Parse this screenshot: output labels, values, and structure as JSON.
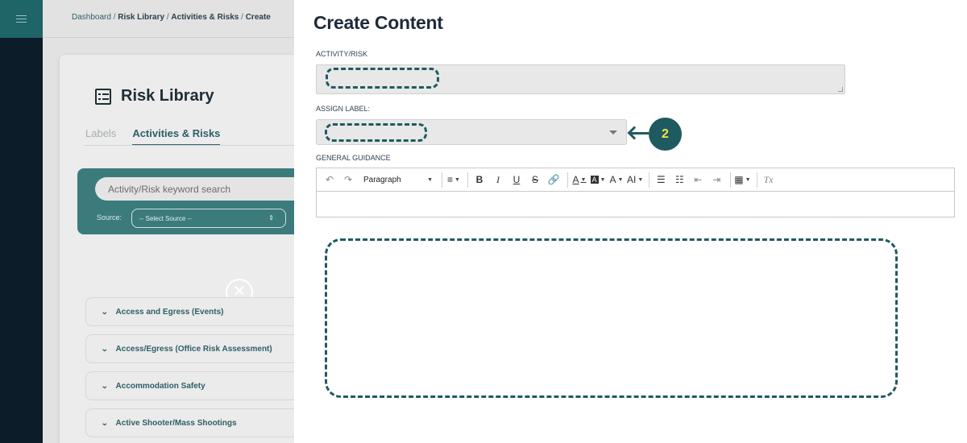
{
  "sidebar": {
    "menu_icon": "hamburger-menu-icon"
  },
  "breadcrumb": {
    "home": "Dashboard",
    "sep": " / ",
    "items": [
      "Risk Library",
      "Activities & Risks",
      "Create"
    ]
  },
  "library": {
    "title": "Risk Library",
    "title_icon": "checklist-icon",
    "tabs": [
      "Labels",
      "Activities & Risks"
    ],
    "active_tab": "Activities & Risks",
    "search_placeholder": "Activity/Risk keyword search",
    "source_label": "Source:",
    "source_value": "-- Select Source --",
    "accordion_items": [
      "Access and Egress (Events)",
      "Access/Egress (Office Risk Assessment)",
      "Accommodation Safety",
      "Active Shooter/Mass Shootings"
    ]
  },
  "panel": {
    "title": "Create Content",
    "activity_label": "ACTIVITY/RISK",
    "activity_value": "",
    "assign_label": "ASSIGN LABEL:",
    "assign_value": "",
    "guidance_label": "GENERAL GUIDANCE",
    "guidance_value": "",
    "step_number": "2"
  },
  "editor_toolbar": {
    "block_format": "Paragraph",
    "bold": "B",
    "italic": "I",
    "underline": "U",
    "strike": "S",
    "font_color": "A",
    "highlight": "A",
    "font_size": "A",
    "text_size": "AI",
    "clear_format": "Tx"
  },
  "colors": {
    "accent": "#1f5a62",
    "badge_text": "#f4e542",
    "sidebar": "#0c1d29"
  }
}
